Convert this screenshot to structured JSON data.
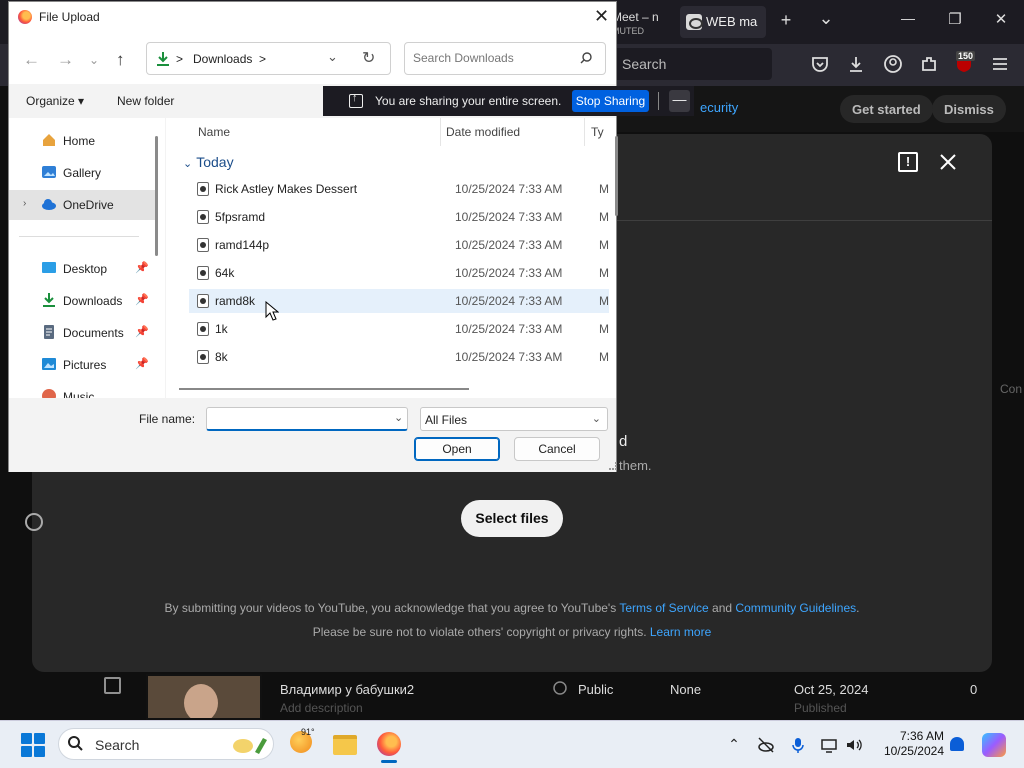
{
  "browser": {
    "tab_meet_title": "Meet – n",
    "tab_meet_sub": "MUTED",
    "tab_web_title": "WEB ma",
    "new_tab": "+",
    "tab_list": "⌄",
    "url_placeholder": "Search",
    "notification_badge": "150",
    "window_minimize": "—",
    "window_restore": "❐",
    "window_close": "✕"
  },
  "youtube": {
    "banner_link": "ecurity",
    "banner_get_started": "Get started",
    "banner_dismiss": "Dismiss",
    "modal_heading": "d",
    "modal_subheading": "them.",
    "select_files_label": "Select files",
    "terms_line1_prefix": "By submitting your videos to YouTube, you acknowledge that you agree to YouTube's ",
    "terms_link1": "Terms of Service",
    "terms_and": " and ",
    "terms_link2": "Community Guidelines",
    "terms_period": ".",
    "terms_line2_prefix": "Please be sure not to violate others' copyright or privacy rights. ",
    "terms_link3": "Learn more",
    "side_text": "Con",
    "video_row": {
      "title": "Владимир у бабушки2",
      "description": "Add description",
      "visibility": "Public",
      "restrictions": "None",
      "date": "Oct 25, 2024",
      "date_status": "Published",
      "views": "0"
    }
  },
  "share_bar": {
    "message": "You are sharing your entire screen.",
    "stop_label": "Stop Sharing",
    "minimize_label": "—"
  },
  "dialog": {
    "title": "File Upload",
    "close": "✕",
    "address_sep": ">",
    "address_location": "Downloads",
    "address_trail": ">",
    "search_placeholder": "Search Downloads",
    "organize_label": "Organize ▾",
    "new_folder_label": "New folder",
    "nav": [
      {
        "label": "Home",
        "icon": "home-icon"
      },
      {
        "label": "Gallery",
        "icon": "gallery-icon"
      },
      {
        "label": "OneDrive",
        "icon": "onedrive-icon"
      },
      {
        "label": "Desktop",
        "icon": "desktop-icon"
      },
      {
        "label": "Downloads",
        "icon": "downloads-icon"
      },
      {
        "label": "Documents",
        "icon": "documents-icon"
      },
      {
        "label": "Pictures",
        "icon": "pictures-icon"
      },
      {
        "label": "Music",
        "icon": "music-icon"
      }
    ],
    "columns": {
      "name": "Name",
      "date": "Date modified",
      "type": "Ty"
    },
    "group_label": "Today",
    "files": [
      {
        "name": "Rick Astley Makes Dessert",
        "date": "10/25/2024 7:33 AM",
        "type": "M"
      },
      {
        "name": "5fpsramd",
        "date": "10/25/2024 7:33 AM",
        "type": "M"
      },
      {
        "name": "ramd144p",
        "date": "10/25/2024 7:33 AM",
        "type": "M"
      },
      {
        "name": "64k",
        "date": "10/25/2024 7:33 AM",
        "type": "M"
      },
      {
        "name": "ramd8k",
        "date": "10/25/2024 7:33 AM",
        "type": "M"
      },
      {
        "name": "1k",
        "date": "10/25/2024 7:33 AM",
        "type": "M"
      },
      {
        "name": "8k",
        "date": "10/25/2024 7:33 AM",
        "type": "M"
      }
    ],
    "file_name_label": "File name:",
    "file_name_value": "",
    "file_type_value": "All Files",
    "open_label": "Open",
    "cancel_label": "Cancel"
  },
  "taskbar": {
    "search_label": "Search",
    "weather_temp": "91°",
    "time": "7:36 AM",
    "date": "10/25/2024"
  },
  "colors": {
    "accent": "#0067c0",
    "share_button": "#0061e0",
    "youtube_link": "#3ea6ff",
    "hover_row": "#e5f0fb"
  }
}
